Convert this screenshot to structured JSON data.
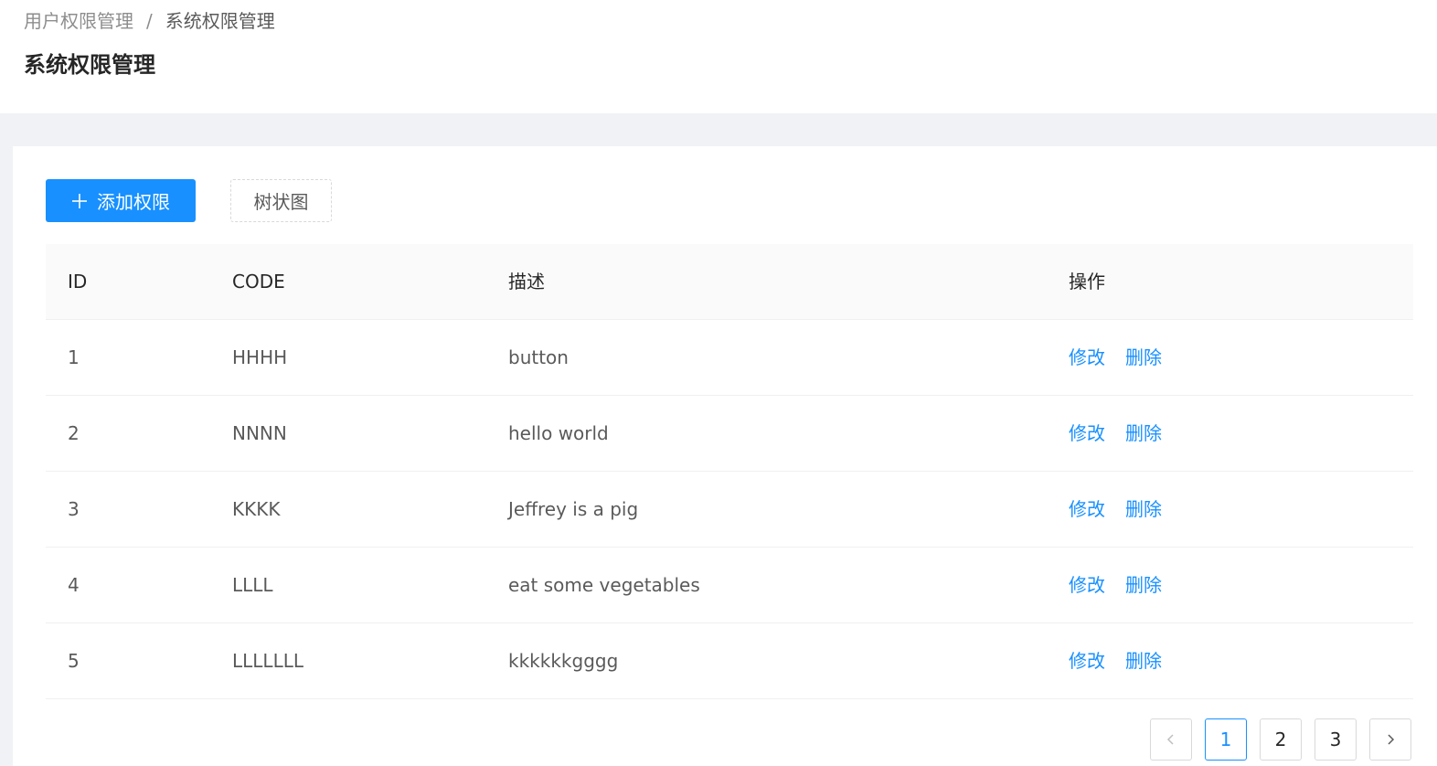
{
  "breadcrumb": {
    "parent": "用户权限管理",
    "separator": "/",
    "current": "系统权限管理"
  },
  "page_title": "系统权限管理",
  "toolbar": {
    "add_label": "添加权限",
    "add_icon": "plus-icon",
    "tree_label": "树状图"
  },
  "table": {
    "columns": {
      "id": "ID",
      "code": "CODE",
      "desc": "描述",
      "ops": "操作"
    },
    "rows": [
      {
        "id": "1",
        "code": "HHHH",
        "desc": "button",
        "edit": "修改",
        "delete": "删除"
      },
      {
        "id": "2",
        "code": "NNNN",
        "desc": "hello world",
        "edit": "修改",
        "delete": "删除"
      },
      {
        "id": "3",
        "code": "KKKK",
        "desc": "Jeffrey is a pig",
        "edit": "修改",
        "delete": "删除"
      },
      {
        "id": "4",
        "code": "LLLL",
        "desc": "eat some vegetables",
        "edit": "修改",
        "delete": "删除"
      },
      {
        "id": "5",
        "code": "LLLLLLL",
        "desc": "kkkkkkgggg",
        "edit": "修改",
        "delete": "删除"
      }
    ]
  },
  "pagination": {
    "pages": [
      "1",
      "2",
      "3"
    ],
    "current": "1",
    "prev_icon": "chevron-left-icon",
    "next_icon": "chevron-right-icon"
  },
  "colors": {
    "primary": "#1890ff",
    "background": "#f0f2f5",
    "table_header_bg": "#fafafa"
  }
}
